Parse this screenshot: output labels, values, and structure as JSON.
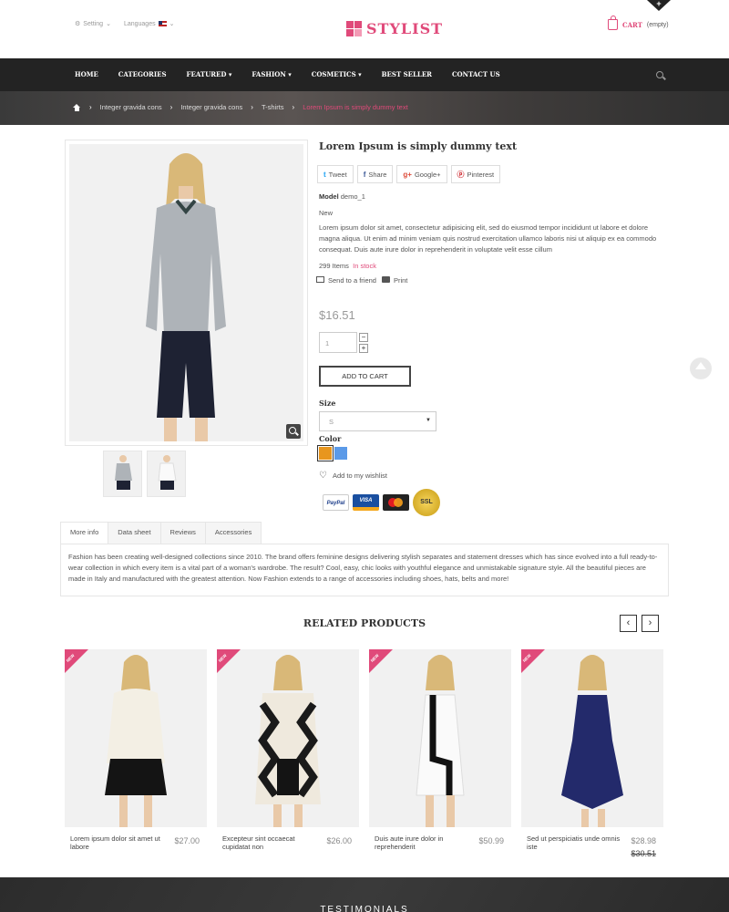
{
  "topbar": {
    "setting": "Setting",
    "languages": "Languages",
    "brand": "STYLIST",
    "cart_label": "CART",
    "cart_status": "(empty)"
  },
  "nav": {
    "items": [
      "HOME",
      "CATEGORIES",
      "FEATURED",
      "FASHION",
      "COSMETICS",
      "BEST SELLER",
      "CONTACT US"
    ]
  },
  "breadcrumb": [
    "Integer gravida cons",
    "Integer gravida cons",
    "T-shirts",
    "Lorem Ipsum is simply dummy text"
  ],
  "product": {
    "title": "Lorem Ipsum is simply dummy text",
    "share": [
      "Tweet",
      "Share",
      "Google+",
      "Pinterest"
    ],
    "model_label": "Model",
    "model_value": "demo_1",
    "condition": "New",
    "description": "Lorem ipsum dolor sit amet, consectetur adipisicing elit, sed do eiusmod tempor incididunt ut labore et dolore magna aliqua. Ut enim ad minim veniam quis nostrud exercitation ullamco laboris nisi ut aliquip ex ea commodo consequat. Duis aute irure dolor in reprehenderit in voluptate velit esse cillum",
    "items_count": "299 Items",
    "stock": "In stock",
    "send_friend": "Send to a friend",
    "print": "Print",
    "price": "$16.51",
    "quantity": "1",
    "add_to_cart": "ADD TO CART",
    "size_label": "Size",
    "size_value": "S",
    "color_label": "Color",
    "colors": [
      "#e8961e",
      "#5b9ae8"
    ],
    "wishlist": "Add to my wishlist",
    "payments": [
      "PayPal",
      "VISA",
      "MasterCard",
      "SSL"
    ]
  },
  "tabs": {
    "items": [
      "More info",
      "Data sheet",
      "Reviews",
      "Accessories"
    ],
    "content": "Fashion has been creating well-designed collections since 2010. The brand offers feminine designs delivering stylish separates and statement dresses which has since evolved into a full ready-to-wear collection in which every item is a vital part of a woman's wardrobe. The result? Cool, easy, chic looks with youthful elegance and unmistakable signature style. All the beautiful pieces are made in Italy and manufactured with the greatest attention. Now Fashion extends to a range of accessories including shoes, hats, belts and more!"
  },
  "related": {
    "title": "RELATED PRODUCTS",
    "badge": "NEW",
    "products": [
      {
        "name": "Lorem ipsum dolor sit amet ut labore",
        "price": "$27.00",
        "old_price": ""
      },
      {
        "name": "Excepteur sint occaecat cupidatat non",
        "price": "$26.00",
        "old_price": ""
      },
      {
        "name": "Duis aute irure dolor in reprehenderit",
        "price": "$50.99",
        "old_price": ""
      },
      {
        "name": "Sed ut perspiciatis unde omnis iste",
        "price": "$28.98",
        "old_price": "$30.51"
      }
    ]
  },
  "footer": {
    "testimonials": "TESTIMONIALS"
  },
  "colors": {
    "accent": "#e04a7a",
    "nav_bg": "#232323"
  }
}
